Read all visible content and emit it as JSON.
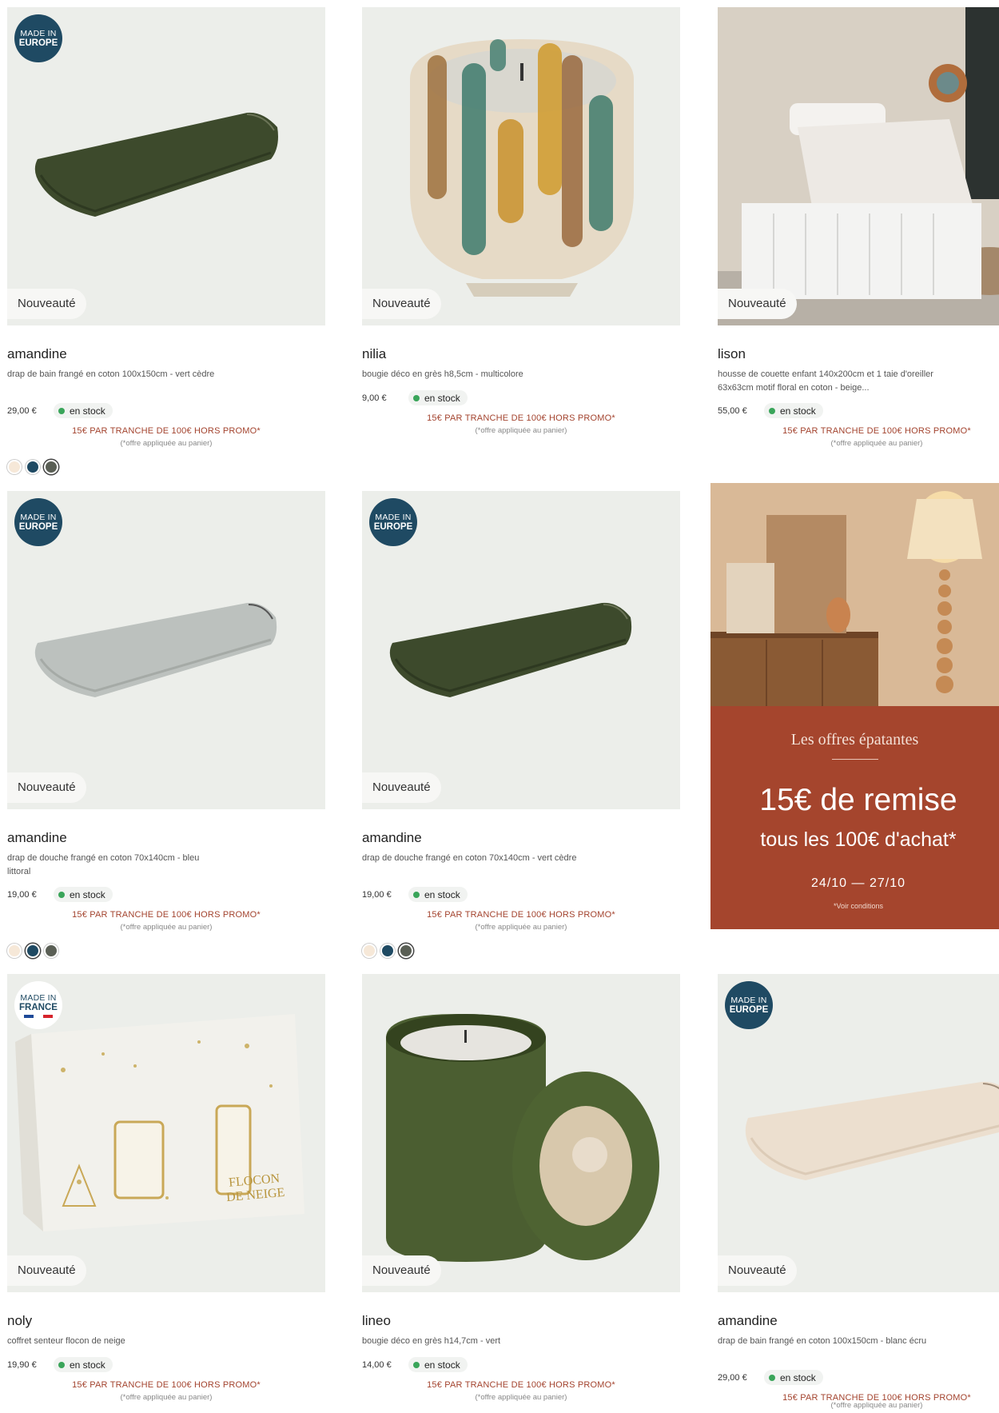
{
  "colors": {
    "promo": "#a3432e",
    "banner_bg": "#a5452d",
    "stock_dot": "#3aa55a",
    "origin_badge": "#1f4a63"
  },
  "products": [
    {
      "badge": "Nouveauté",
      "origin": {
        "line1": "MADE IN",
        "line2": "EUROPE"
      },
      "name": "amandine",
      "description": "drap de bain frangé en coton 100x150cm - vert cèdre",
      "price": "29,00 €",
      "stock": "en stock",
      "promo": "15€ PAR TRANCHE DE 100€ HORS PROMO*",
      "promo_note": "(*offre appliquée au panier)",
      "swatches": [
        "#f6e8d8",
        "#1f4a63",
        "#5a5f55"
      ]
    },
    {
      "badge": "Nouveauté",
      "name": "nilia",
      "description": "bougie déco en grès h8,5cm - multicolore",
      "price": "9,00 €",
      "stock": "en stock",
      "promo": "15€ PAR TRANCHE DE 100€ HORS PROMO*",
      "promo_note": "(*offre appliquée au panier)"
    },
    {
      "badge": "Nouveauté",
      "name": "lison",
      "description": "housse de couette enfant 140x200cm et 1 taie d'oreiller 63x63cm motif floral en coton - beige...",
      "price": "55,00 €",
      "stock": "en stock",
      "promo": "15€ PAR TRANCHE DE 100€ HORS PROMO*",
      "promo_note": "(*offre appliquée au panier)"
    },
    {
      "badge": "Nouveauté",
      "origin": {
        "line1": "MADE IN",
        "line2": "EUROPE"
      },
      "name": "amandine",
      "description": "drap de douche frangé en coton 70x140cm - bleu littoral",
      "price": "19,00 €",
      "stock": "en stock",
      "promo": "15€ PAR TRANCHE DE 100€ HORS PROMO*",
      "promo_note": "(*offre appliquée au panier)",
      "swatches": [
        "#f6e8d8",
        "#1f4a63",
        "#5a5f55"
      ]
    },
    {
      "badge": "Nouveauté",
      "origin": {
        "line1": "MADE IN",
        "line2": "EUROPE"
      },
      "name": "amandine",
      "description": "drap de douche frangé en coton 70x140cm - vert cèdre",
      "price": "19,00 €",
      "stock": "en stock",
      "promo": "15€ PAR TRANCHE DE 100€ HORS PROMO*",
      "promo_note": "(*offre appliquée au panier)",
      "swatches": [
        "#f6e8d8",
        "#1f4a63",
        "#5a5f55"
      ]
    },
    {
      "badge": "Nouveauté",
      "origin": {
        "line1": "MADE IN",
        "line2": "FRANCE"
      },
      "name": "noly",
      "description": "coffret senteur flocon de neige",
      "price": "19,90 €",
      "stock": "en stock",
      "promo": "15€ PAR TRANCHE DE 100€ HORS PROMO*",
      "promo_note": "(*offre appliquée au panier)",
      "packaging_text": "FLOCON DE NEIGE"
    },
    {
      "badge": "Nouveauté",
      "name": "lineo",
      "description": "bougie déco en grès h14,7cm - vert",
      "price": "14,00 €",
      "stock": "en stock",
      "promo": "15€ PAR TRANCHE DE 100€ HORS PROMO*",
      "promo_note": "(*offre appliquée au panier)"
    },
    {
      "badge": "Nouveauté",
      "origin": {
        "line1": "MADE IN",
        "line2": "EUROPE"
      },
      "name": "amandine",
      "description": "drap de bain frangé en coton 100x150cm - blanc écru",
      "price": "29,00 €",
      "stock": "en stock",
      "promo": "15€ PAR TRANCHE DE 100€ HORS PROMO*",
      "promo_note": "(*offre appliquée au panier)"
    }
  ],
  "banner": {
    "kicker": "Les offres épatantes",
    "headline": "15€ de remise",
    "subline": "tous les 100€ d'achat*",
    "dates": "24/10 — 27/10",
    "conditions": "*Voir conditions"
  }
}
